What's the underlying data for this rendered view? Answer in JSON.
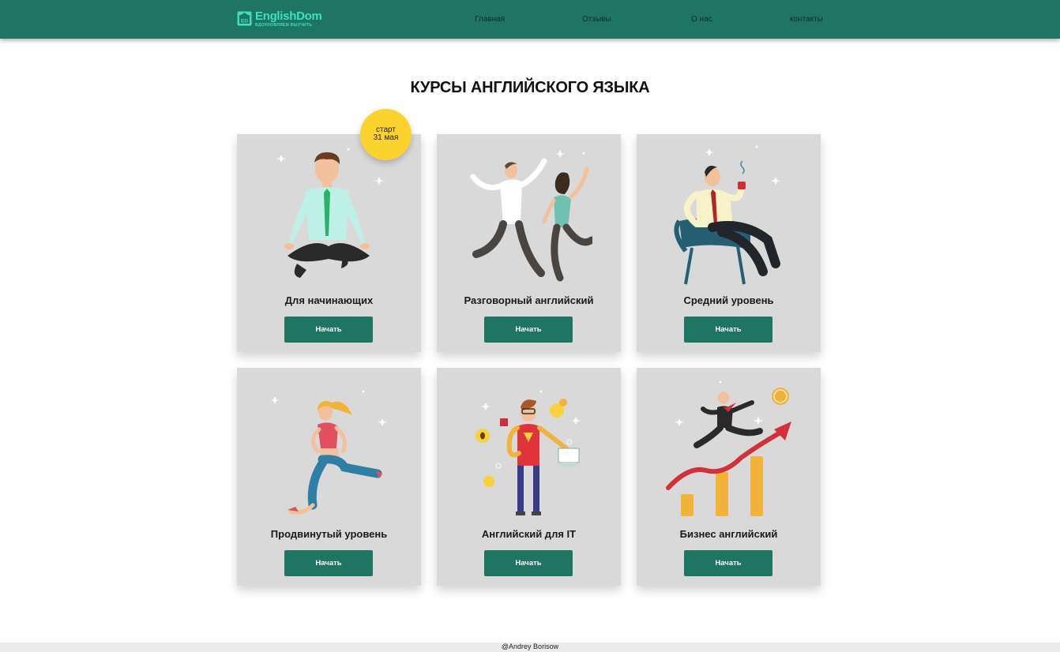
{
  "header": {
    "logo": {
      "name": "EnglishDom",
      "tagline": "ВДОХНОВЛЯЕМ ВЫУЧИТЬ",
      "mark": "ED"
    },
    "nav": [
      {
        "label": "Главная"
      },
      {
        "label": "Отзывы"
      },
      {
        "label": "О нас"
      },
      {
        "label": "контакты"
      }
    ]
  },
  "main": {
    "title": "КУРСЫ АНГЛИЙСКОГО ЯЗЫКА",
    "badge": {
      "line1": "старт",
      "line2": "31 мая"
    },
    "courses": [
      {
        "title": "Для начинающих",
        "button": "Начать",
        "illustration": "meditating-man-icon"
      },
      {
        "title": "Разговорный английский",
        "button": "Начать",
        "illustration": "dancing-couple-icon"
      },
      {
        "title": "Средний уровень",
        "button": "Начать",
        "illustration": "relaxing-man-coffee-icon"
      },
      {
        "title": "Продвинутый уровень",
        "button": "Начать",
        "illustration": "running-woman-icon"
      },
      {
        "title": "Английский для IT",
        "button": "Начать",
        "illustration": "developer-superhero-icon"
      },
      {
        "title": "Бизнес английский",
        "button": "Начать",
        "illustration": "business-growth-chart-icon"
      }
    ]
  },
  "footer": {
    "credit": "@Andrey Borisow"
  },
  "colors": {
    "brand": "#1e7562",
    "brand_accent": "#3fe0bc",
    "card_bg": "#d9d9d9",
    "badge": "#fcd22c"
  }
}
